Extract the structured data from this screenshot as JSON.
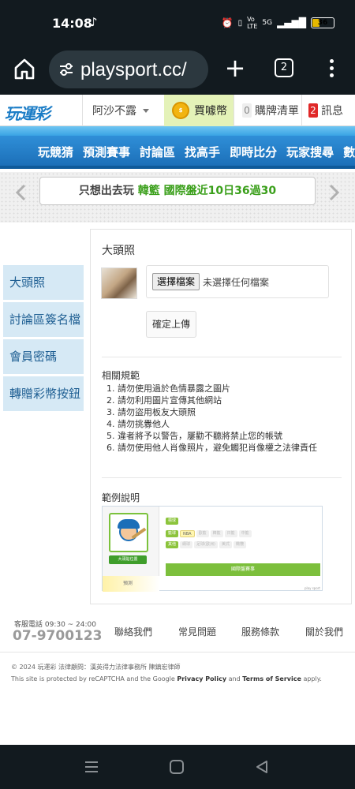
{
  "status_bar": {
    "time": "14:08",
    "network": "5G",
    "battery": "36",
    "battery_level": 0.36
  },
  "browser": {
    "url": "playsport.cc/",
    "tab_count": "2",
    "icons": [
      "home-icon",
      "site-settings-icon",
      "new-tab-icon",
      "tab-switcher-icon",
      "more-menu-icon"
    ]
  },
  "site_header": {
    "logo": "玩運彩",
    "username": "阿沙不露",
    "buy_coins": "買噱幣",
    "cart_count": "0",
    "cart_label": "購牌清單",
    "msg_count": "2",
    "msg_label": "訊息"
  },
  "nav": {
    "items": [
      "玩競猜",
      "預測賽事",
      "討論區",
      "找高手",
      "即時比分",
      "玩家搜尋",
      "數據"
    ]
  },
  "marquee": {
    "prefix": "只想出去玩 ",
    "highlight": "韓籃 國際盤近10日36過30"
  },
  "sidebar": {
    "items": [
      "大頭照",
      "討論區簽名檔",
      "會員密碼",
      "轉贈彩幣按鈕"
    ]
  },
  "avatar_section": {
    "title": "大頭照",
    "choose_file": "選擇檔案",
    "no_file": "未選擇任何檔案",
    "upload_button": "確定上傳"
  },
  "rules": {
    "title": "相關規範",
    "items": [
      "1. 請勿使用過於色情暴露之圖片",
      "2. 請勿利用圖片宣傳其他網站",
      "3. 請勿盜用板友大頭照",
      "4. 請勿挑釁他人",
      "5. 違者將予以警告，屢勸不聽將禁止您的帳號",
      "6. 請勿使用他人肖像照片，避免觸犯肖像權之法律責任"
    ]
  },
  "example": {
    "title": "範例說明",
    "tags_row1": [
      "標球"
    ],
    "tags_row2": [
      "籃球",
      "NBA",
      "歐籃",
      "韓籃",
      "日籃",
      "中籃"
    ],
    "tags_row3": [
      "其他",
      "網球",
      "足球(歐洲)",
      "美式",
      "橄欖"
    ],
    "green_button": "大頭貼位置",
    "bar_label": "國際盤賽事",
    "yellow_label": "預測",
    "foot": "play sport"
  },
  "footer": {
    "service_label": "客服電話 09:30 ~ 24:00",
    "phone": "07-9700123",
    "links": [
      "聯絡我們",
      "常見問題",
      "服務條款",
      "關於我們"
    ],
    "copyright": "© 2024 玩運彩 法律顧問：漢英得力法律事務所 陳鎮宏律師",
    "recaptcha_pre": "This site is protected by reCAPTCHA and the Google ",
    "privacy": "Privacy Policy",
    "and": " and ",
    "terms": "Terms of Service",
    "recaptcha_post": " apply."
  }
}
